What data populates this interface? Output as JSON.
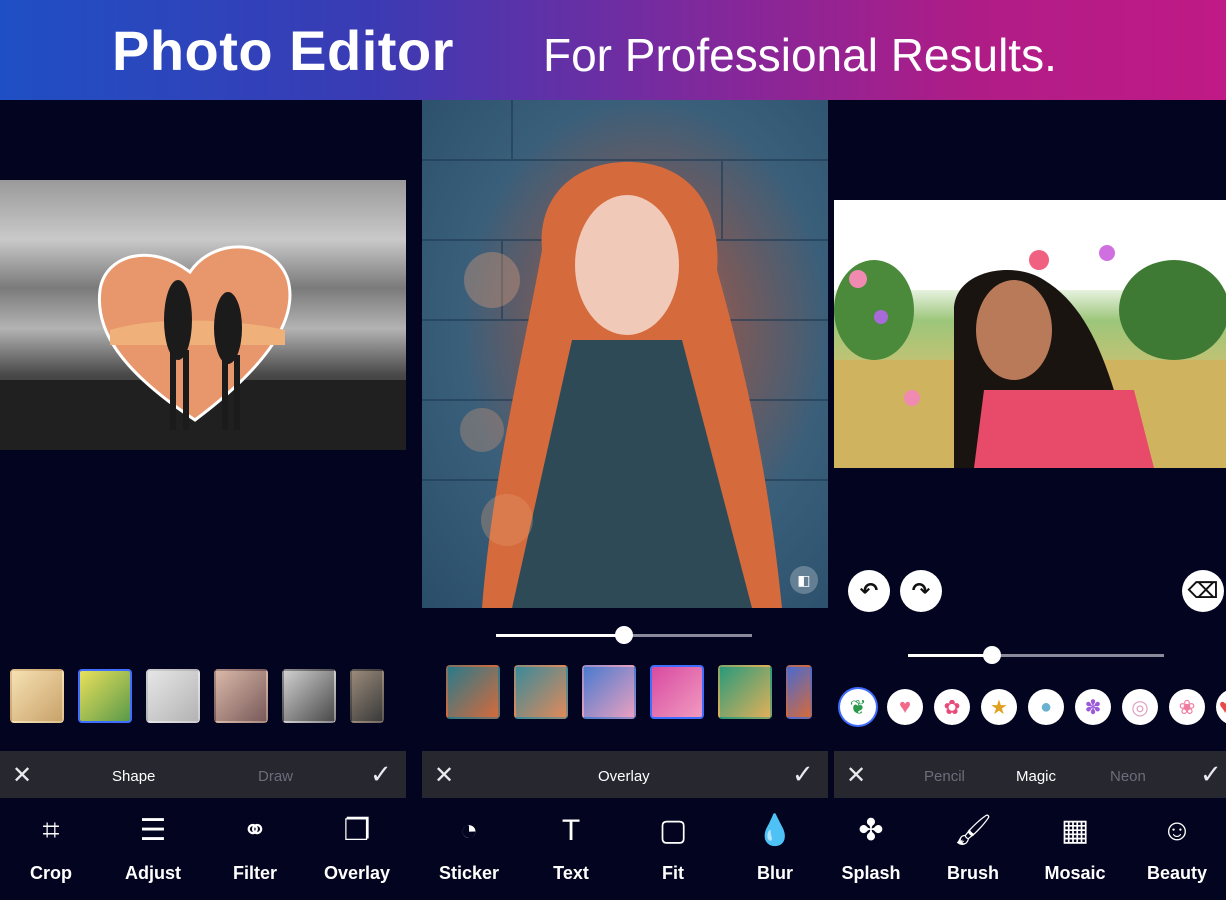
{
  "banner": {
    "title": "Photo Editor",
    "subtitle": "For Professional Results."
  },
  "panel1": {
    "slider_value": null,
    "bar": {
      "close": "✕",
      "confirm": "✓",
      "tabs": [
        "Shape",
        "Draw"
      ]
    },
    "tools": [
      {
        "label": "Crop",
        "icon": "crop-icon",
        "glyph": "⌗"
      },
      {
        "label": "Adjust",
        "icon": "adjust-icon",
        "glyph": "☰"
      },
      {
        "label": "Filter",
        "icon": "filter-icon",
        "glyph": "⚭"
      },
      {
        "label": "Overlay",
        "icon": "overlay-icon",
        "glyph": "❐"
      }
    ]
  },
  "panel2": {
    "slider_value": 0.5,
    "bar": {
      "close": "✕",
      "confirm": "✓",
      "tabs": [
        "Overlay"
      ]
    },
    "tools": [
      {
        "label": "Sticker",
        "icon": "sticker-icon",
        "glyph": "◔"
      },
      {
        "label": "Text",
        "icon": "text-icon",
        "glyph": "T"
      },
      {
        "label": "Fit",
        "icon": "fit-icon",
        "glyph": "▢"
      },
      {
        "label": "Blur",
        "icon": "blur-icon",
        "glyph": "💧"
      }
    ]
  },
  "panel3": {
    "slider_value": 0.33,
    "bar": {
      "close": "✕",
      "confirm": "✓",
      "tabs": [
        "Pencil",
        "Magic",
        "Neon"
      ]
    },
    "tools": [
      {
        "label": "Splash",
        "icon": "splash-icon",
        "glyph": "✤"
      },
      {
        "label": "Brush",
        "icon": "brush-icon",
        "glyph": "🖌"
      },
      {
        "label": "Mosaic",
        "icon": "mosaic-icon",
        "glyph": "▦"
      },
      {
        "label": "Beauty",
        "icon": "beauty-icon",
        "glyph": "☺"
      }
    ],
    "actions": {
      "undo": "↶",
      "redo": "↷",
      "eraser": "⌫"
    }
  },
  "colors": {
    "accent": "#3f6dff",
    "background": "#03041f",
    "bar": "#26272f"
  }
}
